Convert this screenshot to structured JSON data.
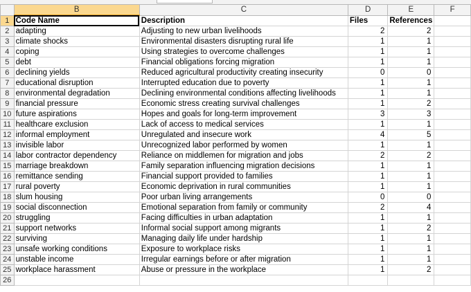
{
  "columns": [
    "B",
    "C",
    "D",
    "E",
    "F"
  ],
  "header_row": {
    "row": "1",
    "code": "Code Name",
    "desc": "Description",
    "files": "Files",
    "refs": "References"
  },
  "rows": [
    {
      "row": "2",
      "code": "adapting",
      "desc": "Adjusting to new urban livelihoods",
      "files": "2",
      "refs": "2"
    },
    {
      "row": "3",
      "code": "climate shocks",
      "desc": "Environmental disasters disrupting rural life",
      "files": "1",
      "refs": "1"
    },
    {
      "row": "4",
      "code": "coping",
      "desc": "Using strategies to overcome challenges",
      "files": "1",
      "refs": "1"
    },
    {
      "row": "5",
      "code": "debt",
      "desc": "Financial obligations forcing migration",
      "files": "1",
      "refs": "1"
    },
    {
      "row": "6",
      "code": "declining yields",
      "desc": "Reduced agricultural productivity creating insecurity",
      "files": "0",
      "refs": "0"
    },
    {
      "row": "7",
      "code": "educational disruption",
      "desc": "Interrupted education due to poverty",
      "files": "1",
      "refs": "1"
    },
    {
      "row": "8",
      "code": "environmental degradation",
      "desc": "Declining environmental conditions affecting livelihoods",
      "files": "1",
      "refs": "1"
    },
    {
      "row": "9",
      "code": "financial pressure",
      "desc": "Economic stress creating survival challenges",
      "files": "1",
      "refs": "2"
    },
    {
      "row": "10",
      "code": "future aspirations",
      "desc": "Hopes and goals for long-term improvement",
      "files": "3",
      "refs": "3"
    },
    {
      "row": "11",
      "code": "healthcare exclusion",
      "desc": "Lack of access to medical services",
      "files": "1",
      "refs": "1"
    },
    {
      "row": "12",
      "code": "informal employment",
      "desc": "Unregulated and insecure work",
      "files": "4",
      "refs": "5"
    },
    {
      "row": "13",
      "code": "invisible labor",
      "desc": "Unrecognized labor performed by women",
      "files": "1",
      "refs": "1"
    },
    {
      "row": "14",
      "code": "labor contractor dependency",
      "desc": "Reliance on middlemen for migration and jobs",
      "files": "2",
      "refs": "2"
    },
    {
      "row": "15",
      "code": "marriage breakdown",
      "desc": "Family separation influencing migration decisions",
      "files": "1",
      "refs": "1"
    },
    {
      "row": "16",
      "code": "remittance sending",
      "desc": "Financial support provided to families",
      "files": "1",
      "refs": "1"
    },
    {
      "row": "17",
      "code": "rural poverty",
      "desc": "Economic deprivation in rural communities",
      "files": "1",
      "refs": "1"
    },
    {
      "row": "18",
      "code": "slum housing",
      "desc": "Poor urban living arrangements",
      "files": "0",
      "refs": "0"
    },
    {
      "row": "19",
      "code": "social disconnection",
      "desc": "Emotional separation from family or community",
      "files": "2",
      "refs": "4"
    },
    {
      "row": "20",
      "code": "struggling",
      "desc": "Facing difficulties in urban adaptation",
      "files": "1",
      "refs": "1"
    },
    {
      "row": "21",
      "code": "support networks",
      "desc": "Informal social support among migrants",
      "files": "1",
      "refs": "2"
    },
    {
      "row": "22",
      "code": "surviving",
      "desc": "Managing daily life under hardship",
      "files": "1",
      "refs": "1"
    },
    {
      "row": "23",
      "code": "unsafe working conditions",
      "desc": "Exposure to workplace risks",
      "files": "1",
      "refs": "1"
    },
    {
      "row": "24",
      "code": "unstable income",
      "desc": "Irregular earnings before or after migration",
      "files": "1",
      "refs": "1"
    },
    {
      "row": "25",
      "code": "workplace harassment",
      "desc": "Abuse or pressure in the workplace",
      "files": "1",
      "refs": "2"
    }
  ],
  "last_row": "26",
  "selected_column": "B",
  "active_cell": "B1"
}
